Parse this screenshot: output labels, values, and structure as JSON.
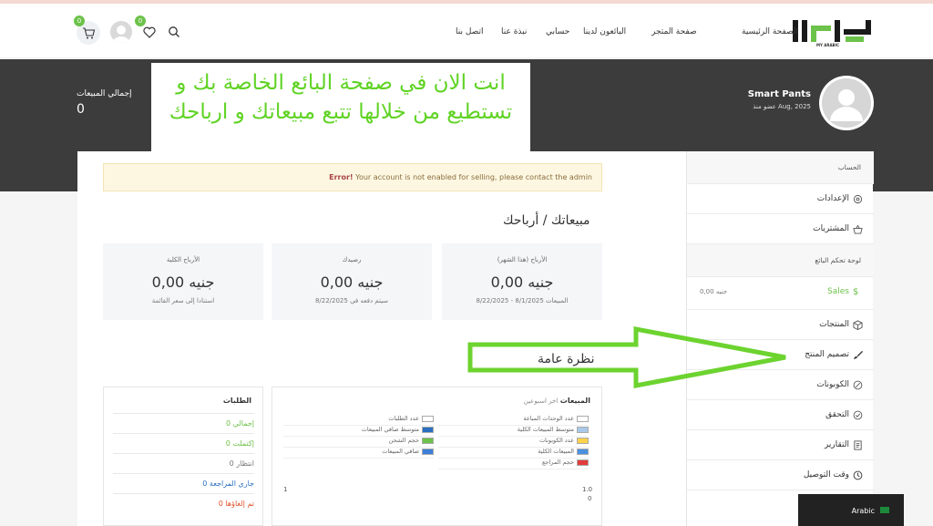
{
  "header": {
    "logo_text": "الراسل",
    "logo_sub": "MY ARABIC",
    "nav": [
      "الصفحة الرئيسية",
      "صفحة المتجر",
      "البائعون لدينا",
      "حسابي",
      "نبذة عنا",
      "اتصل بنا"
    ],
    "wishlist_count": "0",
    "cart_count": "0"
  },
  "banner": {
    "total_sales_label": "إجمالي المبيعات",
    "total_sales_value": "0",
    "store_name": "Smart Pants",
    "member_since": "عضو منذ Aug, 2025"
  },
  "annotation": {
    "text": "انت الان في صفحة البائع الخاصة بك و تستطيع من خلالها تتبع مبيعاتك و ارباحك"
  },
  "error": {
    "strong": "Error!",
    "message": "Your account is not enabled for selling, please contact the admin"
  },
  "earnings": {
    "title": "مبيعاتك / أرباحك",
    "cards": [
      {
        "label": "الأرباح (هذا الشهر)",
        "value": "جنيه 0,00",
        "sub": "المبيعات 8/1/2025 - 8/22/2025"
      },
      {
        "label": "رصيدك",
        "value": "جنيه 0,00",
        "sub": "سيتم دفعه في 8/22/2025"
      },
      {
        "label": "الأرباح الكلية",
        "value": "جنيه 0,00",
        "sub": "استنادا إلى سعر القائمة"
      }
    ]
  },
  "overview": {
    "title": "نظرة عامة"
  },
  "sales_chart": {
    "title": "المبيعات",
    "period": "اخر اسبوعين",
    "legend_right": [
      "عدد الوحدات المباعة",
      "متوسط المبيعات الكلية",
      "عدد الكوبونات",
      "المبيعات الكلية",
      "حجم المراجع"
    ],
    "legend_left": [
      "عدد الطلبات",
      "متوسط صافي المبيعات",
      "حجم الشحن",
      "صافي المبيعات"
    ],
    "colors_right": [
      "#ffffff",
      "#a8c8e8",
      "#ffd24a",
      "#4a90e2",
      "#e23b3b"
    ],
    "colors_left": [
      "#ffffff",
      "#2a6fc0",
      "#6cc24a",
      "#3d7ed8"
    ],
    "y_right_top": "1.0",
    "y_right_bottom": "0",
    "y_left": "1"
  },
  "orders": {
    "title": "الطلبات",
    "rows": [
      {
        "text": "إجمالي 0",
        "color": "#6cc24a"
      },
      {
        "text": "إكتملت 0",
        "color": "#6cc24a"
      },
      {
        "text": "انتظار 0",
        "color": "#777777"
      },
      {
        "text": "جاري المراجعة 0",
        "color": "#2a6fc0"
      },
      {
        "text": "تم إلغاؤها 0",
        "color": "#e2542a"
      }
    ]
  },
  "sidebar": {
    "account_head": "الحساب",
    "settings": "الإعدادات",
    "purchases": "المشتريات",
    "dashboard_head": "لوحة تحكم البائع",
    "sales": "Sales",
    "sales_amount": "جنيه 0,00",
    "products": "المنتجات",
    "product_design": "تصميم المنتج",
    "coupons": "الكوبونات",
    "verification": "التحقق",
    "reports": "التقارير",
    "delivery_time": "وقت التوصيل"
  },
  "language": {
    "label": "Arabic"
  }
}
